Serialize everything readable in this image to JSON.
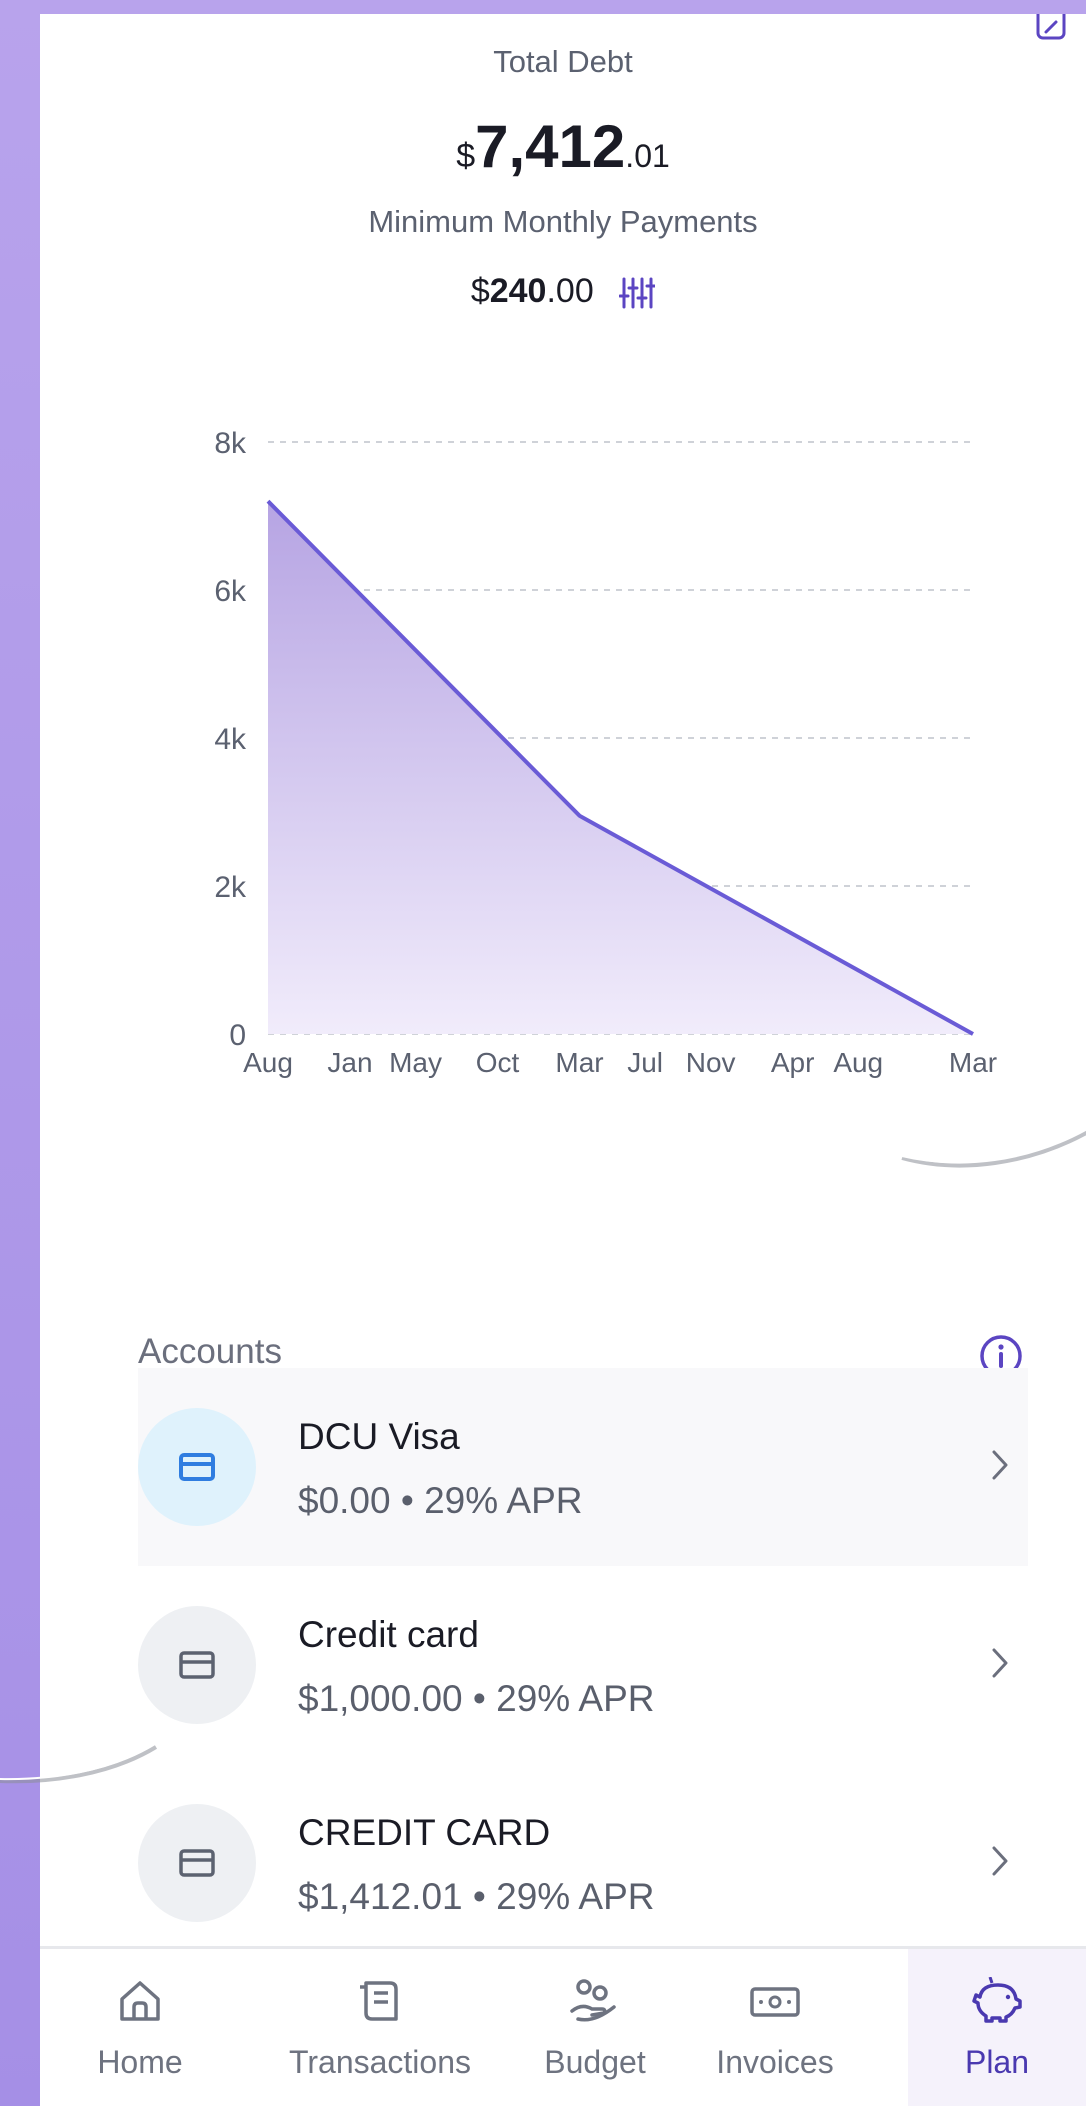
{
  "summary": {
    "total_label": "Total Debt",
    "total_currency": "$",
    "total_whole": "7,412",
    "total_cents": ".01",
    "min_label": "Minimum Monthly Payments",
    "min_currency": "$",
    "min_whole": "240",
    "min_cents": ".00"
  },
  "icons": {
    "edit": "edit-icon",
    "adjust": "sliders-icon",
    "info": "info-icon"
  },
  "colors": {
    "accent": "#5b45c2",
    "line": "#6a5bd6",
    "area_top": "#b6a4e3",
    "area_bottom": "#f1ecfb"
  },
  "chart_data": {
    "type": "area",
    "title": "",
    "xlabel": "",
    "ylabel": "",
    "ylim": [
      0,
      8000
    ],
    "y_ticks": [
      0,
      2000,
      4000,
      6000,
      8000
    ],
    "y_tick_labels": [
      "0",
      "2k",
      "4k",
      "6k",
      "8k"
    ],
    "x_tick_labels": [
      "Aug",
      "Jan",
      "May",
      "Oct",
      "Mar",
      "Jul",
      "Nov",
      "Apr",
      "Aug",
      "Mar"
    ],
    "x_tick_months": [
      0,
      5,
      9,
      14,
      19,
      23,
      27,
      32,
      36,
      43
    ],
    "grid": true,
    "series": [
      {
        "x_months": [
          0,
          19,
          43
        ],
        "values": [
          7200,
          2950,
          0
        ]
      }
    ]
  },
  "accounts": {
    "title": "Accounts",
    "items": [
      {
        "name": "DCU Visa",
        "detail": "$0.00 • 29% APR",
        "icon": "credit-card-icon"
      },
      {
        "name": "Credit card",
        "detail": "$1,000.00 • 29% APR",
        "icon": "credit-card-icon"
      },
      {
        "name": "CREDIT CARD",
        "detail": "$1,412.01 • 29% APR",
        "icon": "credit-card-icon"
      }
    ]
  },
  "nav": {
    "items": [
      {
        "label": "Home",
        "icon": "home-icon"
      },
      {
        "label": "Transactions",
        "icon": "receipt-icon"
      },
      {
        "label": "Budget",
        "icon": "budget-icon"
      },
      {
        "label": "Invoices",
        "icon": "invoice-icon"
      },
      {
        "label": "Plan",
        "icon": "piggy-bank-icon"
      }
    ],
    "active": "Plan"
  }
}
